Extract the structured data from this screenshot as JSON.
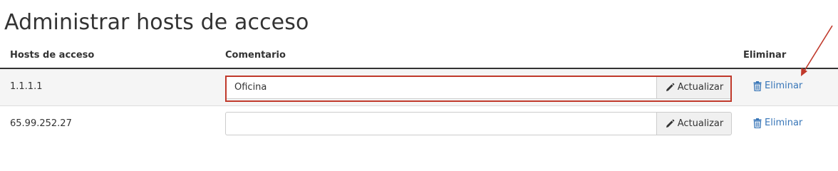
{
  "page": {
    "title": "Administrar hosts de acceso"
  },
  "table": {
    "headers": {
      "host": "Hosts de acceso",
      "comment": "Comentario",
      "delete": "Eliminar"
    },
    "rows": [
      {
        "host": "1.1.1.1",
        "comment_value": "Oficina",
        "update_label": "Actualizar",
        "delete_label": "Eliminar",
        "highlighted": true
      },
      {
        "host": "65.99.252.27",
        "comment_value": "",
        "update_label": "Actualizar",
        "delete_label": "Eliminar",
        "highlighted": false
      }
    ]
  },
  "colors": {
    "link": "#3876b8",
    "annotation_red": "#c0392b",
    "row_stripe": "#f5f5f5"
  },
  "icons": {
    "update": "pencil-icon",
    "delete": "trash-icon"
  }
}
